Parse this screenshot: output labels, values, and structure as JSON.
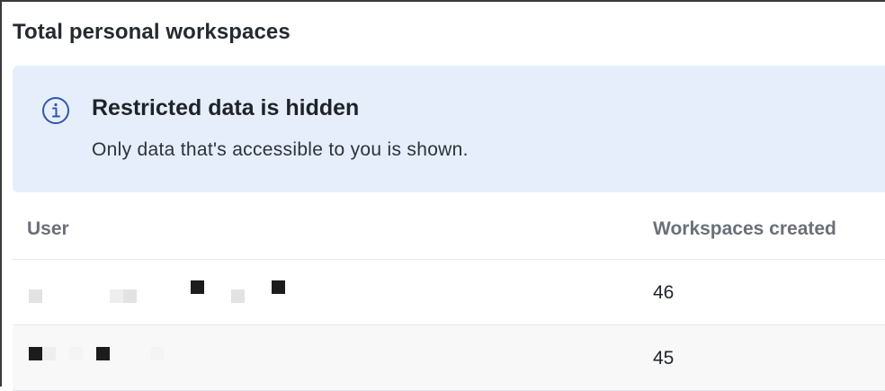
{
  "panel": {
    "title": "Total personal workspaces"
  },
  "banner": {
    "icon": "info-icon",
    "title": "Restricted data is hidden",
    "message": "Only data that's accessible to you is shown.",
    "background_color": "#e6eefb",
    "icon_color": "#2f5aa8"
  },
  "table": {
    "columns": [
      "User",
      "Workspaces created"
    ],
    "rows": [
      {
        "user": "",
        "user_redacted": true,
        "workspaces_created": "46"
      },
      {
        "user": "",
        "user_redacted": true,
        "workspaces_created": "45"
      }
    ]
  }
}
